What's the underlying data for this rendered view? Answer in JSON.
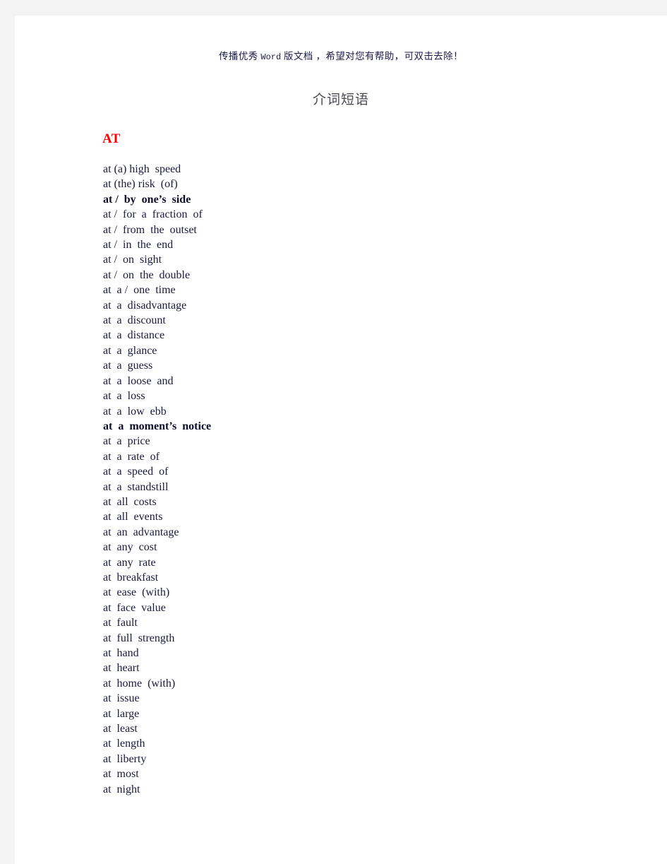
{
  "page": {
    "header_note_prefix": "传播优秀 ",
    "header_note_latin": "Word",
    "header_note_suffix": " 版文档 ，希望对您有帮助，可双击去除！",
    "title": "介词短语",
    "accent_color": "#ff0000",
    "title_color": "#4b4b55",
    "text_color": "#1a1a3c",
    "surround_color": "#f3f3f4"
  },
  "section": {
    "heading": "AT",
    "items": [
      {
        "text": "at (a) high  speed",
        "bold": false
      },
      {
        "text": "at (the) risk  (of)",
        "bold": false
      },
      {
        "text": "at /  by  one’s  side",
        "bold": true
      },
      {
        "text": "at /  for  a  fraction  of",
        "bold": false
      },
      {
        "text": "at /  from  the  outset",
        "bold": false
      },
      {
        "text": "at /  in  the  end",
        "bold": false
      },
      {
        "text": "at /  on  sight",
        "bold": false
      },
      {
        "text": "at /  on  the  double",
        "bold": false
      },
      {
        "text": "at  a /  one  time",
        "bold": false
      },
      {
        "text": "at  a  disadvantage",
        "bold": false
      },
      {
        "text": "at  a  discount",
        "bold": false
      },
      {
        "text": "at  a  distance",
        "bold": false
      },
      {
        "text": "at  a  glance",
        "bold": false
      },
      {
        "text": "at  a  guess",
        "bold": false
      },
      {
        "text": "at  a  loose  and",
        "bold": false
      },
      {
        "text": "at  a  loss",
        "bold": false
      },
      {
        "text": "at  a  low  ebb",
        "bold": false
      },
      {
        "text": "at  a  moment’s  notice",
        "bold": true
      },
      {
        "text": "at  a  price",
        "bold": false
      },
      {
        "text": "at  a  rate  of",
        "bold": false
      },
      {
        "text": "at  a  speed  of",
        "bold": false
      },
      {
        "text": "at  a  standstill",
        "bold": false
      },
      {
        "text": "at  all  costs",
        "bold": false
      },
      {
        "text": "at  all  events",
        "bold": false
      },
      {
        "text": "at  an  advantage",
        "bold": false
      },
      {
        "text": "at  any  cost",
        "bold": false
      },
      {
        "text": "at  any  rate",
        "bold": false
      },
      {
        "text": "at  breakfast",
        "bold": false
      },
      {
        "text": "at  ease  (with)",
        "bold": false
      },
      {
        "text": "at  face  value",
        "bold": false
      },
      {
        "text": "at  fault",
        "bold": false
      },
      {
        "text": "at  full  strength",
        "bold": false
      },
      {
        "text": "at  hand",
        "bold": false
      },
      {
        "text": "at  heart",
        "bold": false
      },
      {
        "text": "at  home  (with)",
        "bold": false
      },
      {
        "text": "at  issue",
        "bold": false
      },
      {
        "text": "at  large",
        "bold": false
      },
      {
        "text": "at  least",
        "bold": false
      },
      {
        "text": "at  length",
        "bold": false
      },
      {
        "text": "at  liberty",
        "bold": false
      },
      {
        "text": "at  most",
        "bold": false
      },
      {
        "text": "at  night",
        "bold": false
      }
    ]
  }
}
